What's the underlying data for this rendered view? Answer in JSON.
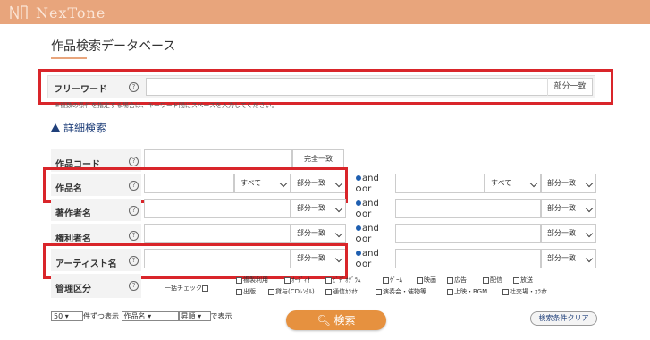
{
  "header": {
    "logo_text": "NexTone",
    "brand_color": "#e8a57c"
  },
  "page": {
    "title": "作品検索データベース"
  },
  "free_word": {
    "label": "フリーワード",
    "help": "?",
    "value": "",
    "match_label": "部分一致",
    "note": "※複数の条件を指定する場合は、キーワード間にスペースを入力してください。"
  },
  "advanced": {
    "toggle_label": "詳細検索"
  },
  "rows": {
    "work_code": {
      "label": "作品コード",
      "help": "?",
      "match": "完全一致"
    },
    "work_name": {
      "label": "作品名",
      "help": "?",
      "scope1": "すべて",
      "match1": "部分一致",
      "and": "and",
      "or": "or",
      "scope2": "すべて",
      "match2": "部分一致"
    },
    "author": {
      "label": "著作者名",
      "help": "?",
      "match1": "部分一致",
      "and": "and",
      "or": "or",
      "match2": "部分一致"
    },
    "rights": {
      "label": "権利者名",
      "help": "?",
      "match1": "部分一致",
      "and": "and",
      "or": "or",
      "match2": "部分一致"
    },
    "artist": {
      "label": "アーティスト名",
      "help": "?",
      "match1": "部分一致",
      "and": "and",
      "or": "or",
      "match2": "部分一致"
    },
    "category": {
      "label": "管理区分",
      "help": "?",
      "bulk_check": "一括チェック",
      "items_row1": [
        "複製利用",
        "ｵｰﾃﾞｨｵ",
        "ﾋﾞﾃﾞｵｸﾞﾗﾑ",
        "ｹﾞｰﾑ",
        "映画",
        "広告",
        "配信",
        "放送"
      ],
      "items_row2": [
        "出版",
        "貸与(CDﾚﾝﾀﾙ)",
        "通信ｶﾗｵｹ",
        "演奏会・催物等",
        "上映・BGM",
        "社交場・ｶﾗｵｹ"
      ]
    }
  },
  "bottom": {
    "per_page_value": "50",
    "per_page_suffix": "件ずつ表示",
    "sort_field": "作品名",
    "sort_order": "昇順",
    "sort_suffix": "で表示",
    "search_label": "検索",
    "clear_label": "検索条件クリア"
  }
}
